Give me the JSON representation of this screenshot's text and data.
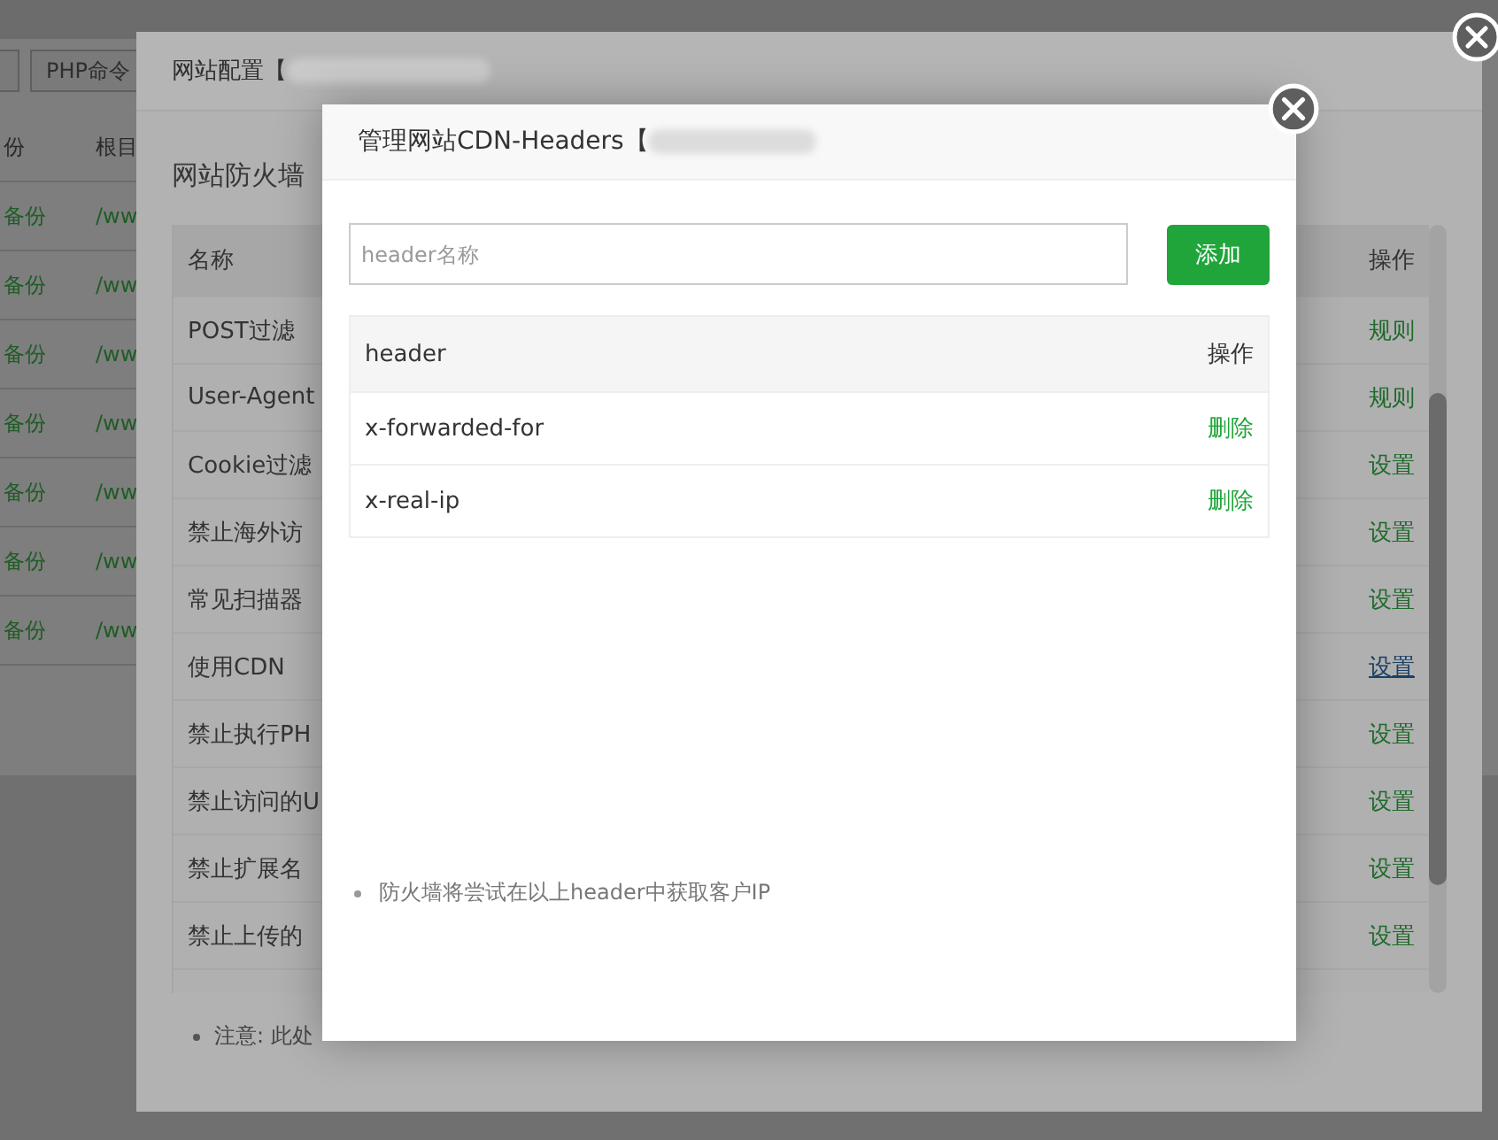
{
  "background_page": {
    "toolbar_buttons": [
      "PHP命令"
    ],
    "table": {
      "columns": [
        "份",
        "根目"
      ],
      "rows": [
        [
          "备份",
          "/ww"
        ],
        [
          "备份",
          "/ww"
        ],
        [
          "备份",
          "/ww"
        ],
        [
          "备份",
          "/ww"
        ],
        [
          "备份",
          "/ww"
        ],
        [
          "备份",
          "/ww"
        ],
        [
          "备份",
          "/ww"
        ]
      ]
    }
  },
  "site_dialog": {
    "title": "网站配置【",
    "section_title": "网站防火墙",
    "table": {
      "columns": [
        "名称",
        "操作"
      ],
      "rows": [
        {
          "name": "POST过滤",
          "action": "规则",
          "hovered": false
        },
        {
          "name": "User-Agent",
          "action": "规则",
          "hovered": false
        },
        {
          "name": "Cookie过滤",
          "action": "设置",
          "hovered": false
        },
        {
          "name": "禁止海外访",
          "action": "设置",
          "hovered": false
        },
        {
          "name": "常见扫描器",
          "action": "设置",
          "hovered": false
        },
        {
          "name": "使用CDN",
          "action": "设置",
          "hovered": true
        },
        {
          "name": "禁止执行PH",
          "action": "设置",
          "hovered": false
        },
        {
          "name": "禁止访问的U",
          "action": "设置",
          "hovered": false
        },
        {
          "name": "禁止扩展名",
          "action": "设置",
          "hovered": false
        },
        {
          "name": "禁止上传的",
          "action": "设置",
          "hovered": false
        }
      ]
    },
    "note": "注意: 此处"
  },
  "cdn_dialog": {
    "title": "管理网站CDN-Headers【",
    "input": {
      "placeholder": "header名称"
    },
    "add_button": "添加",
    "table": {
      "columns": [
        "header",
        "操作"
      ],
      "rows": [
        {
          "header": "x-forwarded-for",
          "action": "删除"
        },
        {
          "header": "x-real-ip",
          "action": "删除"
        }
      ]
    },
    "note": "防火墙将尝试在以上header中获取客户IP"
  }
}
